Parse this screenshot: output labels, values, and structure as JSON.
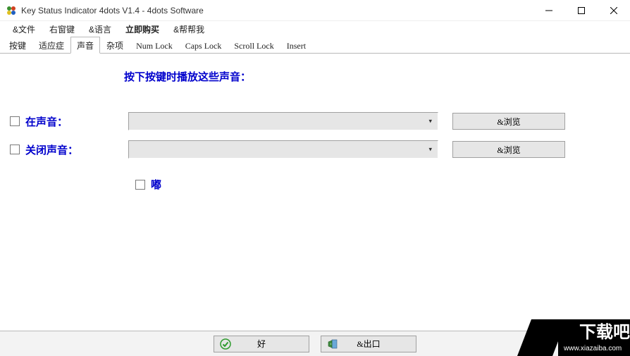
{
  "title": "Key Status Indicator 4dots V1.4 - 4dots Software",
  "menubar": {
    "file": "&文件",
    "rightclick": "右窗键",
    "language": "&语言",
    "buy": "立即购买",
    "help": "&帮帮我"
  },
  "tabs": {
    "keys": "按键",
    "adapt": "适应症",
    "sound": "声音",
    "misc": "杂项",
    "numlock": "Num Lock",
    "capslock": "Caps Lock",
    "scrolllock": "Scroll Lock",
    "insert": "Insert"
  },
  "pane": {
    "header": "按下按键时播放这些声音：",
    "on_sound_label": "在声音：",
    "off_sound_label": "关闭声音：",
    "browse": "&浏览",
    "beep": "嘟"
  },
  "buttons": {
    "ok": "好",
    "exit": "&出口"
  },
  "watermark": {
    "line1": "下载吧",
    "line2": "www.xiazaiba.com"
  }
}
